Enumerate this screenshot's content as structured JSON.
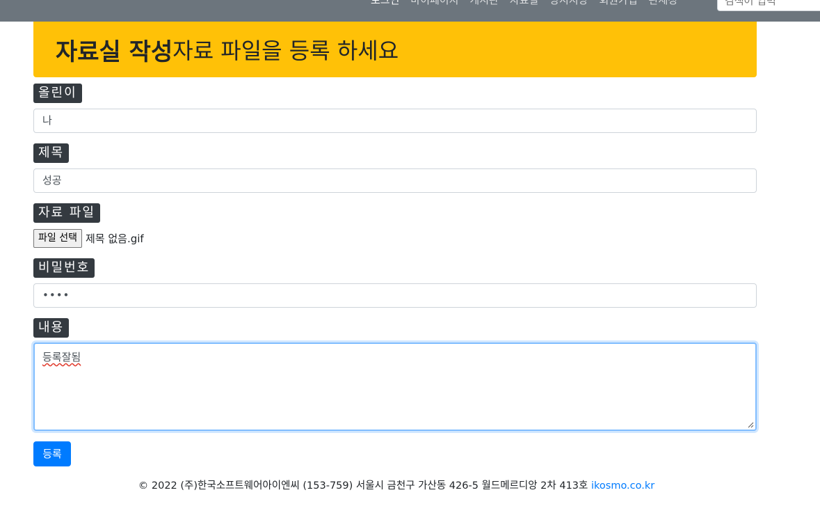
{
  "nav": {
    "links": [
      "로그인",
      "마이페이지",
      "게시판",
      "자료실",
      "방시지망",
      "회원가입",
      "관세정"
    ],
    "search_placeholder": "검색어 입력"
  },
  "jumbotron": {
    "title": "자료실 작성",
    "subtitle": "자료 파일을 등록 하세요"
  },
  "form": {
    "author": {
      "label": "올린이",
      "value": "나"
    },
    "subject": {
      "label": "제목",
      "value": "성공"
    },
    "file": {
      "label": "자료 파일",
      "button_label": "파일 선택",
      "filename": "제목 없음.gif"
    },
    "password": {
      "label": "비밀번호",
      "value": "••••"
    },
    "content": {
      "label": "내용",
      "value": "등록잘됨"
    },
    "submit_label": "등록"
  },
  "footer": {
    "text": "© 2022 (주)한국소프트웨어아이엔씨 (153-759) 서울시 금천구 가산동 426-5 월드메르디앙 2차 413호 ",
    "link": "ikosmo.co.kr"
  },
  "colors": {
    "navbar": "#6c757d",
    "jumbotron": "#ffc107",
    "badge": "#343a40",
    "primary": "#007bff"
  }
}
